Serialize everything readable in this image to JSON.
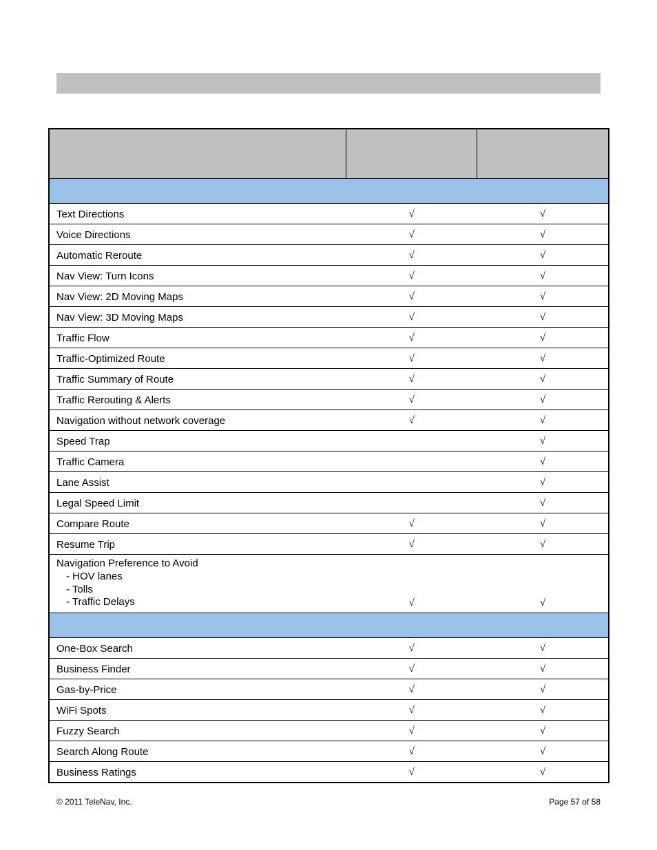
{
  "check": "√",
  "sections": [
    {
      "rows": [
        {
          "label": "Text Directions",
          "a": true,
          "b": true
        },
        {
          "label": "Voice Directions",
          "a": true,
          "b": true
        },
        {
          "label": "Automatic Reroute",
          "a": true,
          "b": true
        },
        {
          "label": "Nav View: Turn Icons",
          "a": true,
          "b": true
        },
        {
          "label": "Nav View: 2D Moving Maps",
          "a": true,
          "b": true
        },
        {
          "label": "Nav View: 3D Moving Maps",
          "a": true,
          "b": true
        },
        {
          "label": "Traffic Flow",
          "a": true,
          "b": true
        },
        {
          "label": "Traffic-Optimized Route",
          "a": true,
          "b": true
        },
        {
          "label": "Traffic Summary of Route",
          "a": true,
          "b": true
        },
        {
          "label": "Traffic Rerouting & Alerts",
          "a": true,
          "b": true
        },
        {
          "label": "Navigation without network coverage",
          "a": true,
          "b": true
        },
        {
          "label": "Speed Trap",
          "a": false,
          "b": true
        },
        {
          "label": "Traffic Camera",
          "a": false,
          "b": true
        },
        {
          "label": "Lane Assist",
          "a": false,
          "b": true
        },
        {
          "label": "Legal Speed Limit",
          "a": false,
          "b": true
        },
        {
          "label": "Compare Route",
          "a": true,
          "b": true
        },
        {
          "label": "Resume Trip",
          "a": true,
          "b": true
        },
        {
          "label": "Navigation Preference to Avoid",
          "sub": [
            "- HOV lanes",
            "- Tolls",
            "- Traffic Delays"
          ],
          "a": true,
          "b": true
        }
      ]
    },
    {
      "rows": [
        {
          "label": "One-Box Search",
          "a": true,
          "b": true
        },
        {
          "label": "Business Finder",
          "a": true,
          "b": true
        },
        {
          "label": "Gas-by-Price",
          "a": true,
          "b": true
        },
        {
          "label": "WiFi Spots",
          "a": true,
          "b": true
        },
        {
          "label": "Fuzzy Search",
          "a": true,
          "b": true
        },
        {
          "label": "Search Along Route",
          "a": true,
          "b": true
        },
        {
          "label": "Business Ratings",
          "a": true,
          "b": true
        }
      ]
    }
  ],
  "footer": {
    "copyright": "© 2011 TeleNav, Inc.",
    "page": "Page 57 of 58"
  }
}
